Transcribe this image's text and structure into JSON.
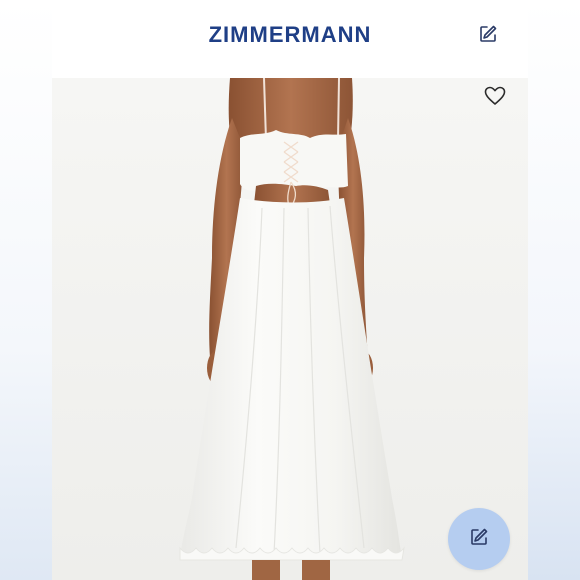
{
  "header": {
    "brand": "ZIMMERMANN",
    "edit_icon": "edit-icon"
  },
  "product_image": {
    "favorite_icon": "heart-icon",
    "colors": {
      "background": "#f3f3f1",
      "dress": "#f7f7f4",
      "skin": "#a76a47"
    }
  },
  "fab": {
    "icon": "edit-icon",
    "color": "#b5cdf0"
  },
  "colors": {
    "brand": "#1f3f86",
    "icon_stroke": "#2a3a66"
  }
}
